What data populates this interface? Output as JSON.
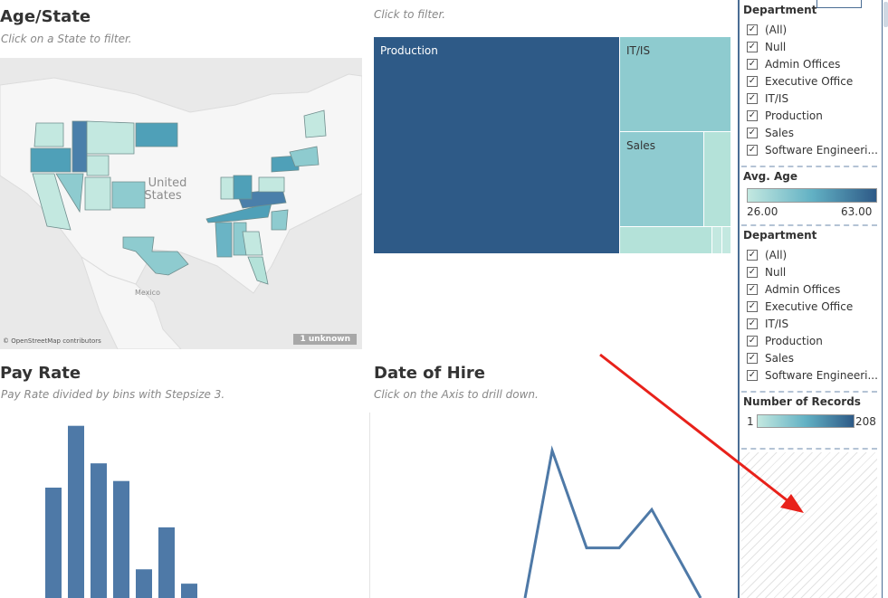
{
  "age_state": {
    "title": "Age/State",
    "subtitle": "Click on a State to filter.",
    "map_country_label": "United States",
    "map_mexico_label": "Mexico",
    "attribution": "© OpenStreetMap contributors",
    "unknown_badge": "1 unknown"
  },
  "treemap": {
    "subtitle": "Click to filter.",
    "labels": {
      "production": "Production",
      "itis": "IT/IS",
      "sales": "Sales"
    },
    "colors": {
      "production": "#2e5a87",
      "itis": "#8ecbcf",
      "sales": "#8fcbd0",
      "light": "#b4e2d9",
      "lighter": "#c3e8e0"
    }
  },
  "pay_rate": {
    "title": "Pay Rate",
    "subtitle": "Pay Rate divided by bins with Stepsize 3.",
    "bar_color": "#4e79a7",
    "chart_data": {
      "type": "bar",
      "relative_values": [
        1.0,
        1.56,
        1.22,
        1.06,
        0.26,
        0.64,
        0.13
      ],
      "note_hidden": ""
    }
  },
  "date_of_hire": {
    "title": "Date of Hire",
    "subtitle": "Click on the Axis to drill down.",
    "line_color": "#4e79a7",
    "chart_data": {
      "type": "line",
      "relative_values": [
        0.0,
        1.0,
        0.34,
        0.34,
        0.6,
        0.0
      ]
    }
  },
  "filters": {
    "department1": {
      "title": "Department",
      "items": [
        "(All)",
        "Null",
        "Admin Offices",
        "Executive Office",
        "IT/IS",
        "Production",
        "Sales",
        "Software Engineeri..."
      ]
    },
    "avg_age": {
      "title": "Avg. Age",
      "min": "26.00",
      "max": "63.00"
    },
    "department2": {
      "title": "Department",
      "items": [
        "(All)",
        "Null",
        "Admin Offices",
        "Executive Office",
        "IT/IS",
        "Production",
        "Sales",
        "Software Engineeri..."
      ]
    },
    "records": {
      "title": "Number of Records",
      "min": "1",
      "max": "208"
    }
  },
  "colors": {
    "accent": "#2e5a87",
    "annotation_arrow": "#e8211a",
    "legend_low": "#c3e8e0",
    "legend_high": "#2e5a87"
  }
}
